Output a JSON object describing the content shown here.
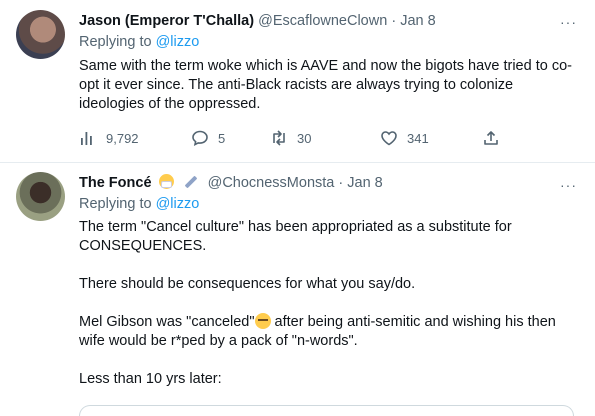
{
  "tweets": [
    {
      "name": "Jason (Emperor T'Challa)",
      "handle": "@EscaflowneClown",
      "separator": "·",
      "date": "Jan 8",
      "more": "···",
      "replying_prefix": "Replying to ",
      "replying_to": "@lizzo",
      "text": "Same with the term woke which is AAVE and now the bigots have tried to co-opt it ever since. The anti-Black racists are always trying to colonize ideologies of the oppressed.",
      "stats": {
        "views": "9,792",
        "replies": "5",
        "retweets": "30",
        "likes": "341"
      }
    },
    {
      "name": "The Foncé",
      "handle": "@ChocnessMonsta",
      "separator": "·",
      "date": "Jan 8",
      "more": "···",
      "replying_prefix": "Replying to ",
      "replying_to": "@lizzo",
      "lines": [
        "The term \"Cancel culture\" has been appropriated as a substitute for CONSEQUENCES.",
        "There should be consequences for what you say/do.",
        "Mel Gibson was \"canceled\"",
        " after being anti-semitic and wishing his then wife would be r*ped by a pack of \"n-words\".",
        "Less than 10 yrs later:"
      ]
    }
  ],
  "icons": {
    "name_emojis": [
      "mask-face-emoji-icon",
      "syringe-emoji-icon"
    ],
    "inline_emoji": "rolling-eyes-emoji-icon"
  },
  "colors": {
    "link": "#1d9bf0",
    "muted": "#536471",
    "text": "#0f1419",
    "divider": "#e6ecf0"
  }
}
